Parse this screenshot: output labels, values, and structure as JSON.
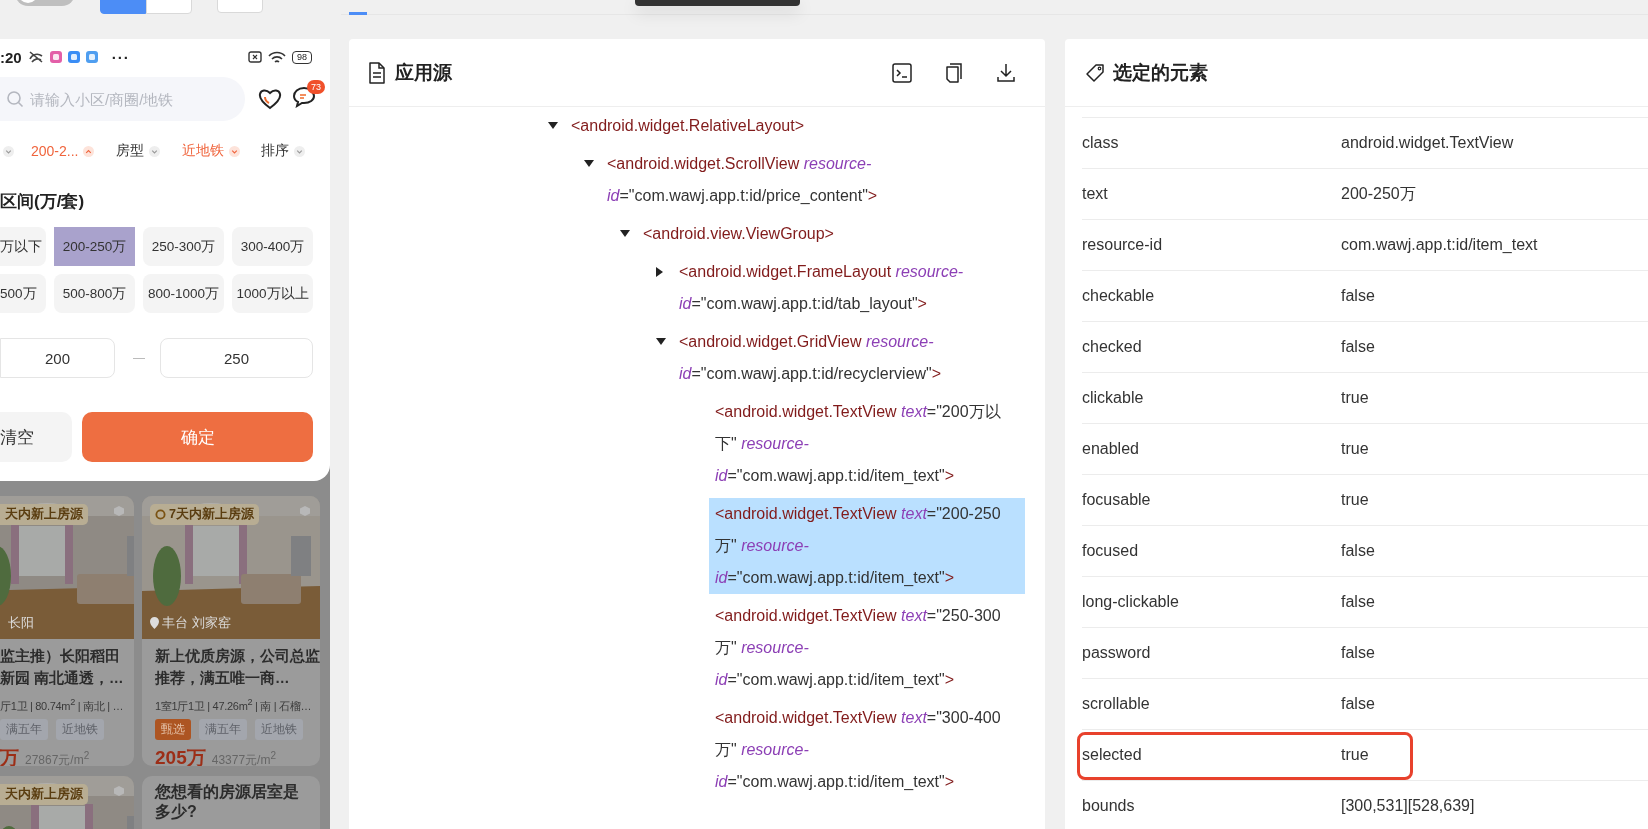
{
  "toolbar": {
    "switch": {
      "on": false
    },
    "view_toggle": [
      {
        "selected": true
      },
      {
        "selected": false
      }
    ]
  },
  "phone": {
    "status_bar": {
      "time": ":20",
      "more": "···",
      "battery": "98"
    },
    "search": {
      "placeholder": "请输入小区/商圈/地铁"
    },
    "message_badge": "73",
    "filters": [
      {
        "active": false,
        "expanded": false
      },
      {
        "label": "200-2...",
        "active": true,
        "expanded": true
      },
      {
        "label": "房型",
        "active": false,
        "expanded": false
      },
      {
        "label": "近地铁",
        "active": true,
        "expanded": false
      },
      {
        "label": "排序",
        "active": false,
        "expanded": false
      }
    ],
    "range_title": "区间(万/套)",
    "price_options": [
      {
        "label": "万以下",
        "selected": false
      },
      {
        "label": "200-250万",
        "selected": true
      },
      {
        "label": "250-300万",
        "selected": false
      },
      {
        "label": "300-400万",
        "selected": false
      },
      {
        "label": "500万",
        "selected": false
      },
      {
        "label": "500-800万",
        "selected": false
      },
      {
        "label": "800-1000万",
        "selected": false
      },
      {
        "label": "1000万以上",
        "selected": false
      }
    ],
    "min_price": "200",
    "max_price": "250",
    "buttons": [
      "清空",
      "确定"
    ],
    "listings": [
      {
        "kind": "house",
        "badge": "天内新上房源",
        "location": "长阳",
        "title": "监主推）长阳稻田新园 南北通透，…",
        "details": "厅1卫 | 80.74m$^{2}$ | 南北 | …",
        "tags": [
          {
            "label": "满五年",
            "kind": "plain"
          },
          {
            "label": "近地铁",
            "kind": "plain"
          }
        ],
        "price": "万",
        "unit_price": "27867元/m$^{2}$"
      },
      {
        "kind": "house",
        "badge": "7天内新上房源",
        "location": "丰台 刘家窑",
        "title": "新上优质房源，公司总监推荐，满五唯一商…",
        "details": "1室1厅1卫 | 47.26m$^{2}$ | 南 | 石榴…",
        "tags": [
          {
            "label": "甄选",
            "kind": "featured"
          },
          {
            "label": "满五年",
            "kind": "plain"
          },
          {
            "label": "近地铁",
            "kind": "plain"
          }
        ],
        "price": "205万",
        "unit_price": "43377元/m$^{2}$"
      },
      {
        "kind": "house",
        "badge": "天内新上房源"
      },
      {
        "kind": "question",
        "title": "您想看的房源居室是多少?"
      }
    ]
  },
  "source": {
    "title": "应用源",
    "tree": [
      {
        "tag": "<android.widget.RelativeLayout",
        "end": ">",
        "expanded": true,
        "selected": false,
        "children": [
          {
            "tag": "<android.widget.ScrollView",
            "attrs": [
              {
                "name": "resource-id",
                "value": "=\"com.wawj.app.t:id/price_content\""
              }
            ],
            "end": ">",
            "expanded": true,
            "selected": false,
            "children": [
              {
                "tag": "<android.view.ViewGroup",
                "end": ">",
                "expanded": true,
                "selected": false,
                "children": [
                  {
                    "tag": "<android.widget.FrameLayout",
                    "attrs": [
                      {
                        "name": "resource-id",
                        "value": "=\"com.wawj.app.t:id/tab_layout\""
                      }
                    ],
                    "end": ">",
                    "expanded": false,
                    "selected": false
                  },
                  {
                    "tag": "<android.widget.GridView",
                    "attrs": [
                      {
                        "name": "resource-id",
                        "value": "=\"com.wawj.app.t:id/recyclerview\""
                      }
                    ],
                    "end": ">",
                    "expanded": true,
                    "selected": false,
                    "children": [
                      {
                        "tag": "<android.widget.TextView",
                        "attrs": [
                          {
                            "name": "text",
                            "value": "=\"200万以下\""
                          },
                          {
                            "name": "resource-id",
                            "value": "=\"com.wawj.app.t:id/item_text\""
                          }
                        ],
                        "end": ">",
                        "selected": false
                      },
                      {
                        "tag": "<android.widget.TextView",
                        "attrs": [
                          {
                            "name": "text",
                            "value": "=\"200-250万\""
                          },
                          {
                            "name": "resource-id",
                            "value": "=\"com.wawj.app.t:id/item_text\""
                          }
                        ],
                        "end": ">",
                        "selected": true
                      },
                      {
                        "tag": "<android.widget.TextView",
                        "attrs": [
                          {
                            "name": "text",
                            "value": "=\"250-300万\""
                          },
                          {
                            "name": "resource-id",
                            "value": "=\"com.wawj.app.t:id/item_text\""
                          }
                        ],
                        "end": ">",
                        "selected": false
                      },
                      {
                        "tag": "<android.widget.TextView",
                        "attrs": [
                          {
                            "name": "text",
                            "value": "=\"300-400万\""
                          },
                          {
                            "name": "resource-id",
                            "value": "=\"com.wawj.app.t:id/item_text\""
                          }
                        ],
                        "end": ">",
                        "selected": false
                      }
                    ]
                  }
                ]
              }
            ]
          }
        ]
      }
    ]
  },
  "attributes": {
    "title": "选定的元素",
    "rows": [
      {
        "name": "class",
        "value": "android.widget.TextView",
        "highlighted": false
      },
      {
        "name": "text",
        "value": "200-250万",
        "highlighted": false
      },
      {
        "name": "resource-id",
        "value": "com.wawj.app.t:id/item_text",
        "highlighted": false
      },
      {
        "name": "checkable",
        "value": "false",
        "highlighted": false
      },
      {
        "name": "checked",
        "value": "false",
        "highlighted": false
      },
      {
        "name": "clickable",
        "value": "true",
        "highlighted": false
      },
      {
        "name": "enabled",
        "value": "true",
        "highlighted": false
      },
      {
        "name": "focusable",
        "value": "true",
        "highlighted": false
      },
      {
        "name": "focused",
        "value": "false",
        "highlighted": false
      },
      {
        "name": "long-clickable",
        "value": "false",
        "highlighted": false
      },
      {
        "name": "password",
        "value": "false",
        "highlighted": false
      },
      {
        "name": "scrollable",
        "value": "false",
        "highlighted": false
      },
      {
        "name": "selected",
        "value": "true",
        "highlighted": true
      },
      {
        "name": "bounds",
        "value": "[300,531][528,639]",
        "highlighted": false
      }
    ]
  }
}
